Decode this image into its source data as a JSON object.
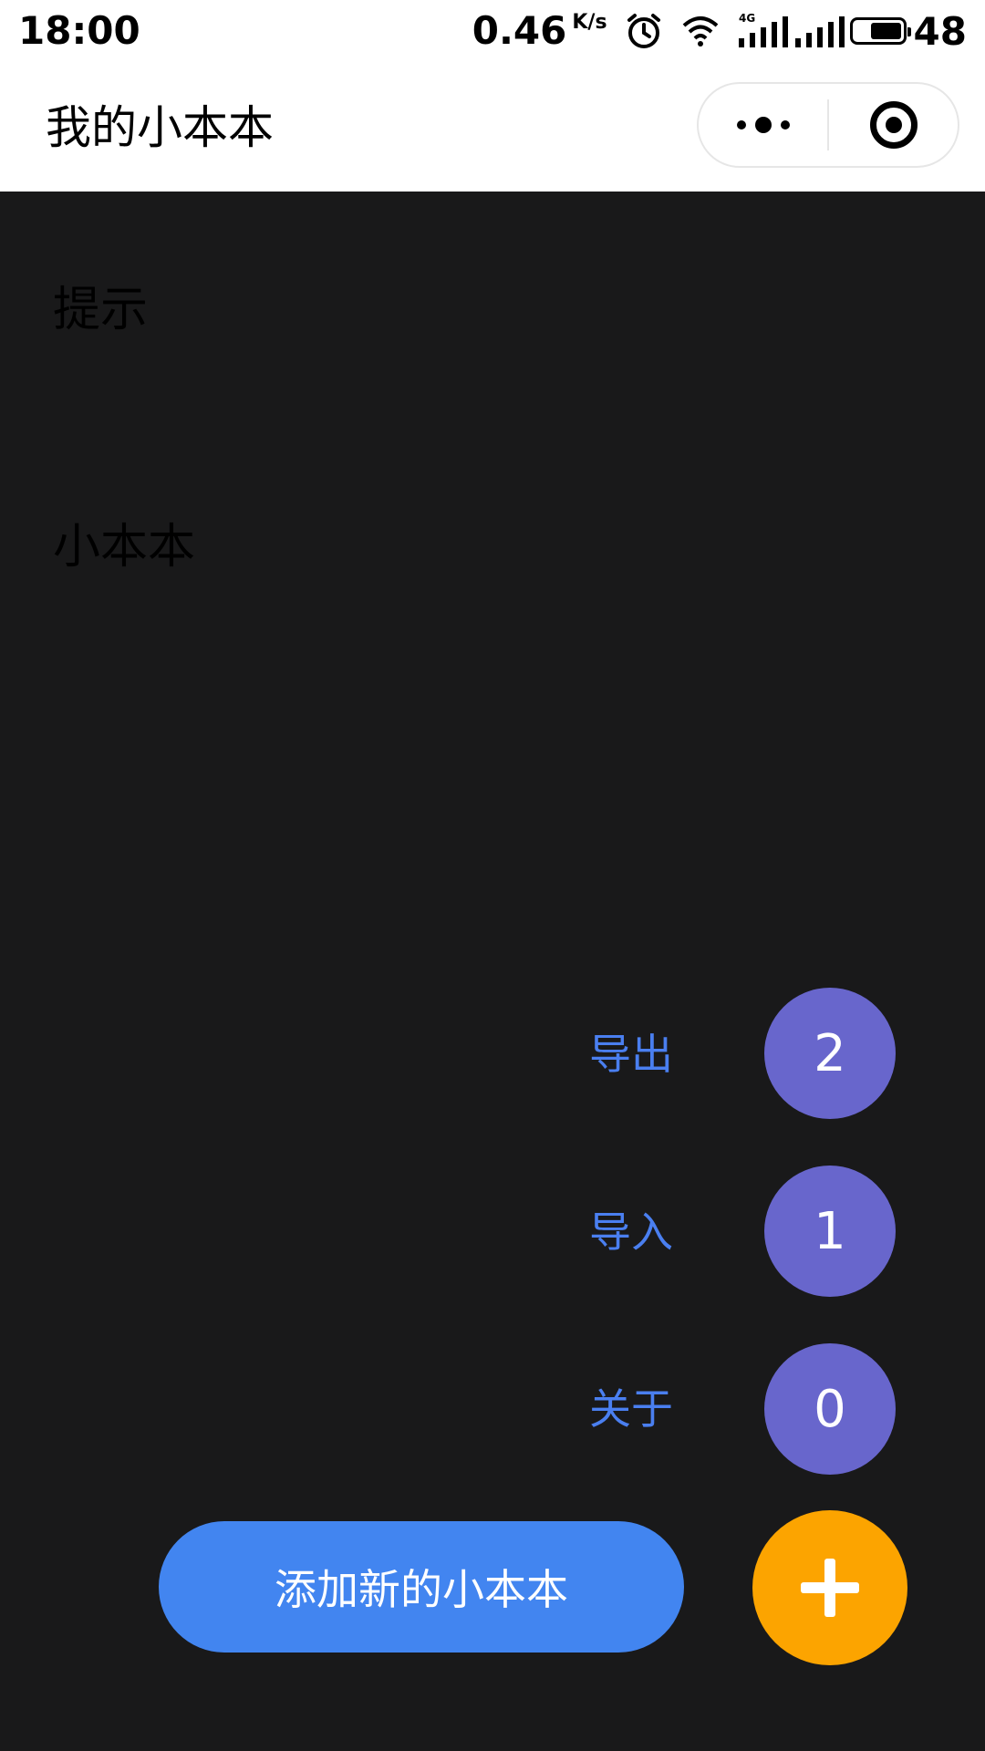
{
  "status_bar": {
    "time": "18:00",
    "network_speed": "0.46",
    "speed_unit": "K/s",
    "network_type": "4G",
    "battery": "48"
  },
  "header": {
    "title": "我的小本本",
    "more_icon": "more-dots-icon",
    "close_icon": "target-icon"
  },
  "main": {
    "hint_title": "提示",
    "book_title": "小本本"
  },
  "actions": [
    {
      "label": "导出",
      "badge": "2"
    },
    {
      "label": "导入",
      "badge": "1"
    },
    {
      "label": "关于",
      "badge": "0"
    }
  ],
  "add_button": {
    "label": "添加新的小本本"
  },
  "fab": {
    "icon": "plus-icon"
  },
  "colors": {
    "background": "#19191a",
    "accent_blue": "#4285f0",
    "action_label": "#4a7ff0",
    "action_circle": "#6866cc",
    "fab_orange": "#fca400"
  }
}
